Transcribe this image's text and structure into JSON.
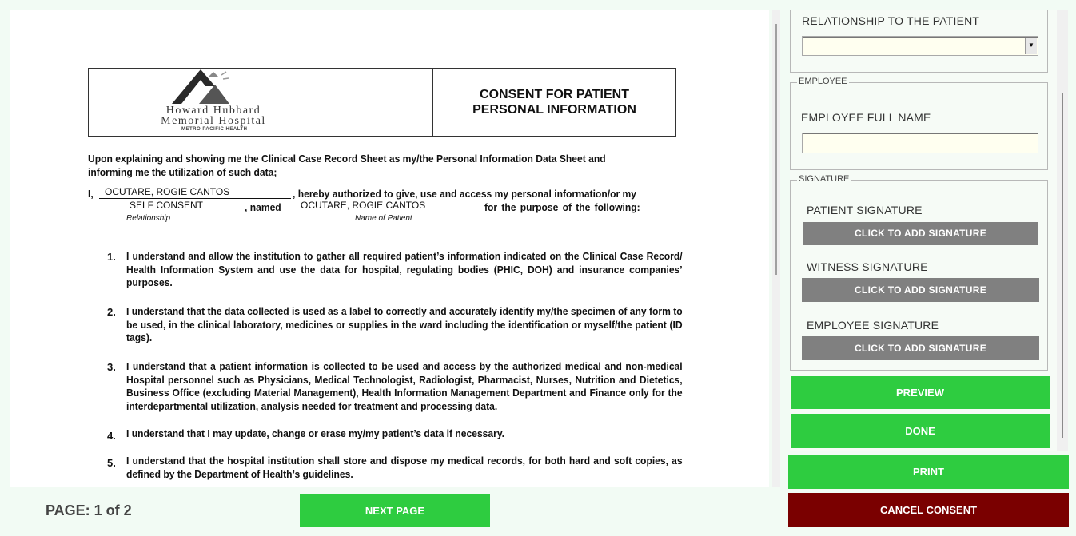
{
  "document": {
    "logo": {
      "name_line1": "Howard Hubbard",
      "name_line2": "Memorial Hospital",
      "sub": "METRO PACIFIC HEALTH"
    },
    "title_line1": "CONSENT FOR PATIENT",
    "title_line2": "PERSONAL INFORMATION",
    "intro": "Upon explaining and showing me the Clinical Case Record Sheet as my/the Personal Information Data Sheet and informing me the utilization of such data;",
    "consent_line1_prefix": "I,",
    "signer_name": "OCUTARE, ROGIE CANTOS",
    "consent_line1_suffix": ", hereby authorized to give, use and access my personal information/or my",
    "relationship_value": "SELF CONSENT",
    "named_text": ",  named",
    "patient_name": "OCUTARE, ROGIE CANTOS",
    "purpose_text": "for  the  purpose  of  the  following:",
    "relationship_caption": "Relationship",
    "patient_caption": "Name of Patient",
    "items": [
      {
        "num": "1.",
        "text": "I understand and allow the institution to gather all required patient’s information indicated on the Clinical Case Record/ Health Information System and use the data for hospital, regulating bodies (PHIC, DOH) and insurance companies’ purposes."
      },
      {
        "num": "2.",
        "text": "I understand that the data collected is used as a label to correctly and accurately identify my/the specimen of any form to be used, in the clinical laboratory, medicines or supplies in the ward including the identification or myself/the patient (ID tags)."
      },
      {
        "num": "3.",
        "text": "I understand that a patient information is collected to be used and access by the authorized medical and non-medical Hospital personnel such as Physicians, Medical Technologist, Radiologist, Pharmacist, Nurses, Nutrition and Dietetics, Business Office (excluding Material Management), Health Information Management Department and Finance only for the interdepartmental utilization, analysis needed for treatment and processing data."
      },
      {
        "num": "4.",
        "text": "I understand that I may update, change or erase my/my patient’s data if necessary."
      },
      {
        "num": "5.",
        "text": "I understand that the hospital institution shall store and dispose my medical records, for both hard and soft copies, as defined by the Department of Health’s guidelines."
      }
    ]
  },
  "panel": {
    "relationship_label": "RELATIONSHIP TO THE PATIENT",
    "relationship_selected": "",
    "employee_legend": "EMPLOYEE",
    "employee_label": "EMPLOYEE FULL NAME",
    "employee_value": "",
    "signature_legend": "SIGNATURE",
    "patient_sig_label": "PATIENT SIGNATURE",
    "witness_sig_label": "WITNESS SIGNATURE",
    "employee_sig_label": "EMPLOYEE SIGNATURE",
    "add_sig_button": "CLICK TO ADD SIGNATURE",
    "preview_button": "PREVIEW",
    "done_button": "DONE"
  },
  "footer": {
    "page_indicator": "PAGE: 1 of 2",
    "next_page_button": "NEXT PAGE",
    "print_button": "PRINT",
    "cancel_button": "CANCEL CONSENT"
  },
  "colors": {
    "green": "#2ecc40",
    "dark_red": "#7a0000",
    "gray_button": "#808080",
    "input_bg": "#fffff0"
  }
}
